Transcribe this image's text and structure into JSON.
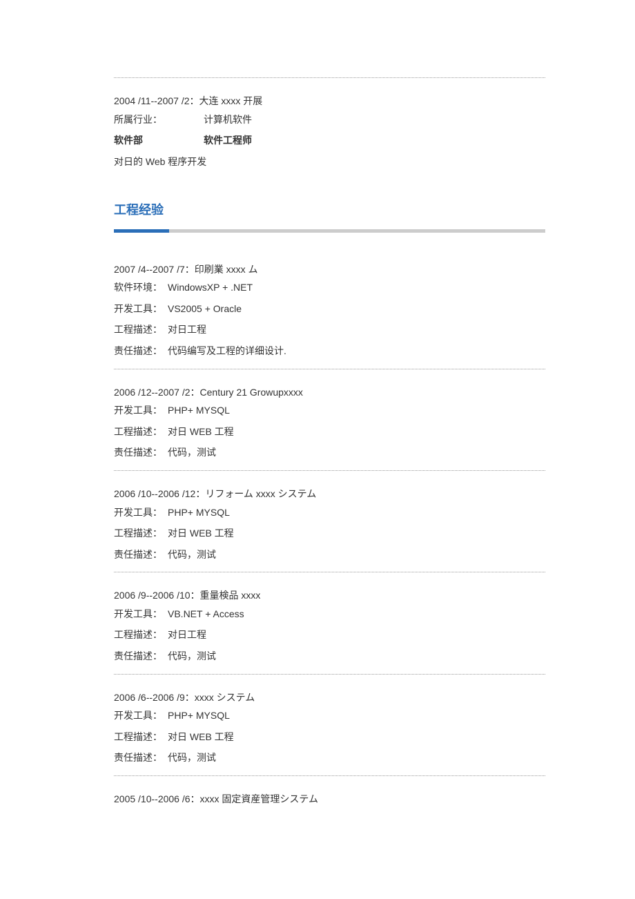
{
  "work": {
    "dateLine": "2004 /11--2007 /2：大连 xxxx 开展",
    "industryLabel": "所属行业：",
    "industryValue": "计算机软件",
    "deptLabel": "软件部",
    "deptValue": "软件工程师",
    "desc": "对日的 Web 程序开发"
  },
  "sectionTitle": "工程经验",
  "projects": [
    {
      "dateLine": "2007 /4--2007 /7：印刷業 xxxx ム",
      "rows": [
        {
          "label": "软件环境：",
          "value": "WindowsXP + .NET"
        },
        {
          "label": "开发工具：",
          "value": "VS2005 + Oracle"
        },
        {
          "label": "工程描述：",
          "value": "对日工程"
        },
        {
          "label": "责任描述：",
          "value": "代码编写及工程的详细设计."
        }
      ]
    },
    {
      "dateLine": "2006 /12--2007 /2：Century 21 Growupxxxx",
      "rows": [
        {
          "label": "开发工具：",
          "value": "PHP+ MYSQL"
        },
        {
          "label": "工程描述：",
          "value": "对日 WEB 工程"
        },
        {
          "label": "责任描述：",
          "value": "代码，测试"
        }
      ]
    },
    {
      "dateLine": "2006 /10--2006 /12：リフォーム xxxx システム",
      "rows": [
        {
          "label": "开发工具：",
          "value": "PHP+ MYSQL"
        },
        {
          "label": "工程描述：",
          "value": "对日 WEB 工程"
        },
        {
          "label": "责任描述：",
          "value": "代码，测试"
        }
      ]
    },
    {
      "dateLine": "2006 /9--2006 /10：重量検品 xxxx",
      "rows": [
        {
          "label": "开发工具：",
          "value": "VB.NET + Access"
        },
        {
          "label": "工程描述：",
          "value": "对日工程"
        },
        {
          "label": "责任描述：",
          "value": "代码，测试"
        }
      ]
    },
    {
      "dateLine": "2006 /6--2006 /9：xxxx システム",
      "rows": [
        {
          "label": "开发工具：",
          "value": "PHP+ MYSQL"
        },
        {
          "label": "工程描述：",
          "value": "对日 WEB 工程"
        },
        {
          "label": "责任描述：",
          "value": "代码，测试"
        }
      ]
    }
  ],
  "lastProject": {
    "dateLine": "2005 /10--2006 /6：xxxx 固定資産管理システム"
  }
}
